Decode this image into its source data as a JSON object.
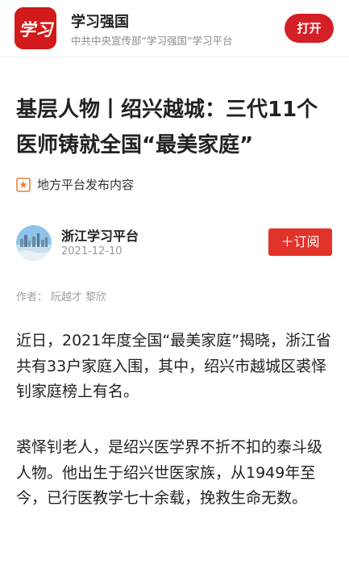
{
  "app_bar": {
    "app_name": "学习强国",
    "app_desc": "中共中央宣传部“学习强国”学习平台",
    "logo_text": "学习",
    "open_label": "打开",
    "accent_color": "#d31f26"
  },
  "article": {
    "title": "基层人物丨绍兴越城：三代11个医师铸就全国“最美家庭”",
    "source_label": "地方平台发布内容",
    "source_icon": "local-platform-badge-icon",
    "channel": {
      "name": "浙江学习平台",
      "date": "2021-12-10",
      "avatar": "city-skyline-avatar",
      "subscribe_label": "＋订阅"
    },
    "byline": {
      "prefix": "作者：",
      "authors": [
        "阮越才",
        "黎欣"
      ]
    },
    "paragraphs": [
      "近日，2021年度全国“最美家庭”揭晓，浙江省共有33户家庭入围，其中，绍兴市越城区裘怿钊家庭榜上有名。",
      "裘怿钊老人，是绍兴医学界不折不扣的泰斗级人物。他出生于绍兴世医家族，从1949年至今，已行医教学七十余载，挽救生命无数。"
    ]
  }
}
